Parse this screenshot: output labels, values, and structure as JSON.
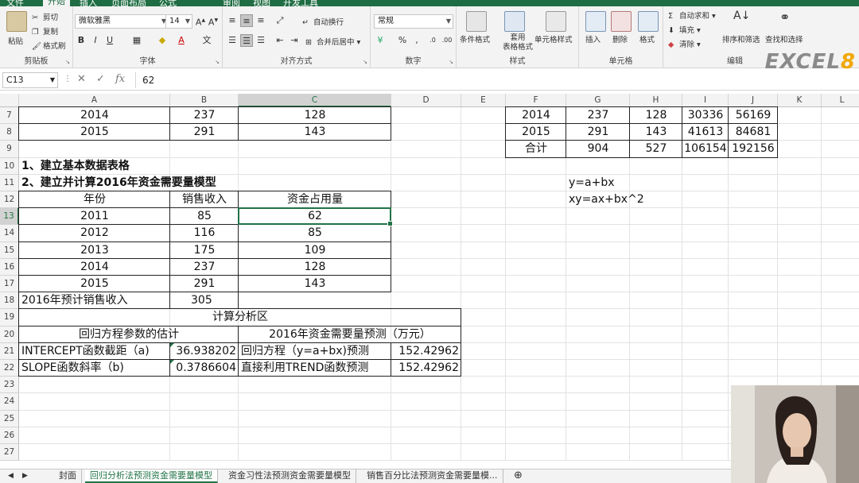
{
  "ribbon": {
    "tabs": [
      "文件",
      "插入",
      "页面布局",
      "公式",
      "开始",
      "审阅",
      "视图",
      "开发工具"
    ],
    "active_tab": "开始",
    "clipboard": {
      "label": "剪贴板",
      "paste": "粘贴",
      "cut": "剪切",
      "copy": "复制",
      "format_painter": "格式刷"
    },
    "font": {
      "label": "字体",
      "name": "微软雅黑",
      "size": "14"
    },
    "alignment": {
      "label": "对齐方式",
      "wrap": "自动换行",
      "merge": "合并后居中"
    },
    "number": {
      "label": "数字",
      "format": "常规"
    },
    "styles": {
      "label": "样式",
      "conditional": "条件格式",
      "table": "套用\n表格格式",
      "cell_styles": "单元格样式"
    },
    "cells": {
      "label": "单元格",
      "insert": "插入",
      "delete": "删除",
      "format": "格式"
    },
    "editing": {
      "label": "编辑",
      "autosum": "自动求和",
      "fill": "填充",
      "clear": "清除",
      "sort": "排序和筛选",
      "find": "查找和选择"
    },
    "logo": "EXCEL8"
  },
  "formula_bar": {
    "name_box": "C13",
    "content": "62"
  },
  "columns": [
    "A",
    "B",
    "C",
    "D",
    "E",
    "F",
    "G",
    "H",
    "I",
    "J",
    "K",
    "L"
  ],
  "selected_column": "C",
  "rows": [
    "7",
    "8",
    "9",
    "10",
    "11",
    "12",
    "13",
    "14",
    "15",
    "16",
    "17",
    "18",
    "19",
    "20",
    "21",
    "22",
    "23",
    "24",
    "25",
    "26",
    "27"
  ],
  "selected_row": "13",
  "cells": {
    "A7": "2014",
    "B7": "237",
    "C7": "128",
    "A8": "2015",
    "B8": "291",
    "C8": "143",
    "A10": "1、建立基本数据表格",
    "A11": "2、建立并计算2016年资金需要量模型",
    "A12": "年份",
    "B12": "销售收入",
    "C12": "资金占用量",
    "A13": "2011",
    "B13": "85",
    "C13": "62",
    "A14": "2012",
    "B14": "116",
    "C14": "85",
    "A15": "2013",
    "B15": "175",
    "C15": "109",
    "A16": "2014",
    "B16": "237",
    "C16": "128",
    "A17": "2015",
    "B17": "291",
    "C17": "143",
    "A18": "2016年预计销售收入",
    "B18": "305",
    "A19": "计算分析区",
    "A20": "回归方程参数的估计",
    "C20": "2016年资金需要量预测（万元）",
    "A21": "INTERCEPT函数截距（a)",
    "B21": "36.938202",
    "C21": "回归方程（y=a+bx)预测",
    "D21": "152.42962",
    "A22": "SLOPE函数斜率（b)",
    "B22": "0.3786604",
    "C22": "直接利用TREND函数预测",
    "D22": "152.42962",
    "F7": "2014",
    "G7": "237",
    "H7": "128",
    "I7": "30336",
    "J7": "56169",
    "F8": "2015",
    "G8": "291",
    "H8": "143",
    "I8": "41613",
    "J8": "84681",
    "F9": "合计",
    "G9": "904",
    "H9": "527",
    "I9": "106154",
    "J9": "192156",
    "G11": "y=a+bx",
    "G12": "xy=ax+bx^2"
  },
  "sheet_tabs": [
    "封面",
    "回归分析法预测资金需要量模型",
    "资金习性法预测资金需要量模型",
    "销售百分比法预测资金需要量模..."
  ],
  "active_sheet": "回归分析法预测资金需要量模型"
}
